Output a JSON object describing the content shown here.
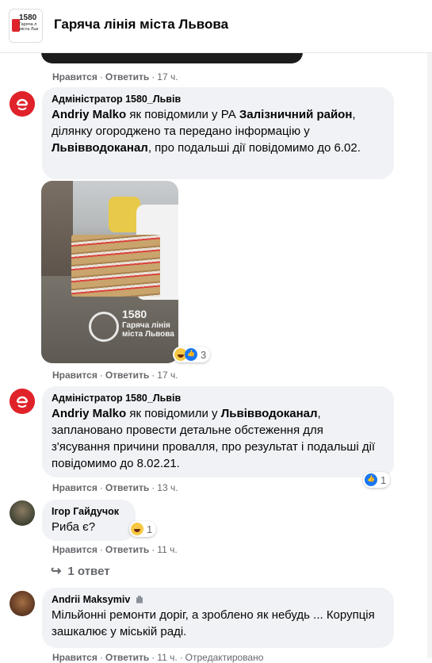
{
  "header": {
    "title": "Гаряча лінія міста Львова",
    "logo_num": "1580",
    "logo_text": "Гаряча л міста Льв"
  },
  "comments": [
    {
      "author": "Адміністратор 1580_Львів",
      "mention": "Andriy Malko",
      "text_parts": [
        " як повідомили у РА ",
        "Залізничний район",
        ", ділянку огороджено та передано інформацію у ",
        "Львівводоканал",
        ", про подальші дії повідомимо до 6.02."
      ]
    },
    {
      "author": "Адміністратор 1580_Львів",
      "mention": "Andriy Malko",
      "text_parts": [
        " як повідомили у ",
        "Львівводоканал",
        ", заплановано провести детальне обстеження для з'ясування причини провалля, про результат і подальші дії повідомимо до 8.02.21."
      ]
    },
    {
      "author": "Ігор Гайдучок",
      "text": "Риба є?"
    },
    {
      "author": "Andrii Maksymiv",
      "text": "Мільйонні ремонти доріг, а зроблено як небудь ... Корупція зашкалює у міській раді."
    }
  ],
  "actions": {
    "like": "Нравится",
    "reply": "Ответить",
    "dot": "·"
  },
  "times": [
    "17 ч.",
    "17 ч.",
    "17 ч.",
    "13 ч.",
    "11 ч.",
    "11 ч."
  ],
  "edited": "Отредактировано",
  "reaction_counts": {
    "photo": "3",
    "comment2": "1",
    "comment3": "1"
  },
  "photo_watermark": {
    "num": "1580",
    "text": "Гаряча лінія міста Львова"
  },
  "replies_label": "1 ответ"
}
